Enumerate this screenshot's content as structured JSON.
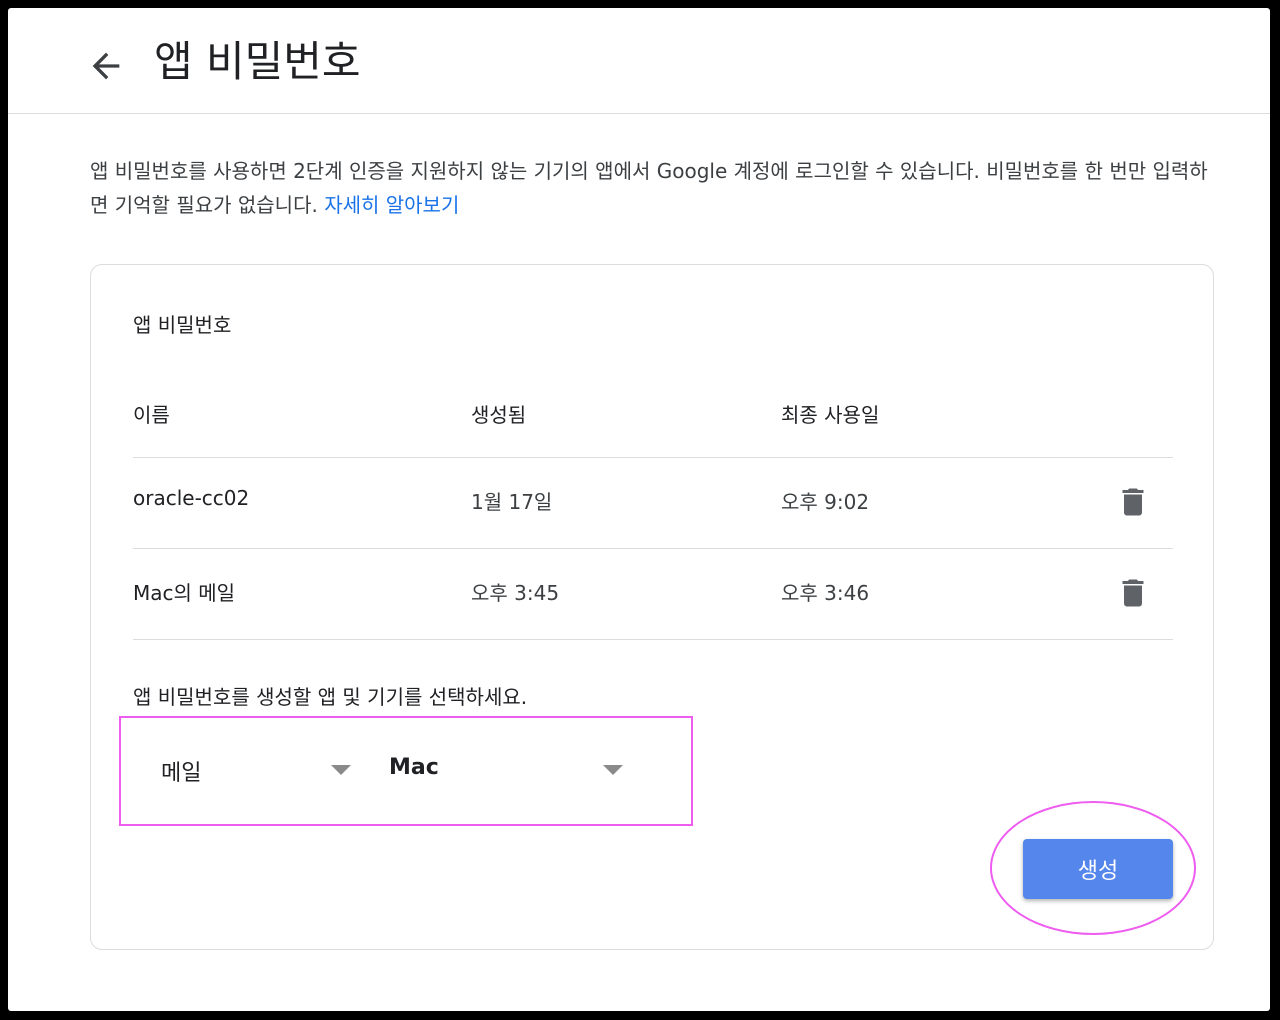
{
  "header": {
    "back_icon": "arrow-left-icon",
    "title": "앱 비밀번호"
  },
  "description": {
    "text": "앱 비밀번호를 사용하면 2단계 인증을 지원하지 않는 기기의 앱에서 Google 계정에 로그인할 수 있습니다. 비밀번호를 한 번만 입력하면 기억할 필요가 없습니다. ",
    "learn_more": "자세히 알아보기"
  },
  "card": {
    "title": "앱 비밀번호",
    "columns": [
      "이름",
      "생성됨",
      "최종 사용일"
    ],
    "rows": [
      {
        "name": "oracle-cc02",
        "created": "1월 17일",
        "last_used": "오후 9:02"
      },
      {
        "name": "Mac의 메일",
        "created": "오후 3:45",
        "last_used": "오후 3:46"
      }
    ],
    "delete_icon": "trash-icon",
    "select_prompt": "앱 비밀번호를 생성할 앱 및 기기를 선택하세요.",
    "app_select": {
      "value": "메일"
    },
    "device_select": {
      "value": "Mac"
    },
    "generate_label": "생성"
  },
  "colors": {
    "accent": "#1a73e8",
    "button": "#5586ec",
    "annotation": "#ee5df0"
  }
}
